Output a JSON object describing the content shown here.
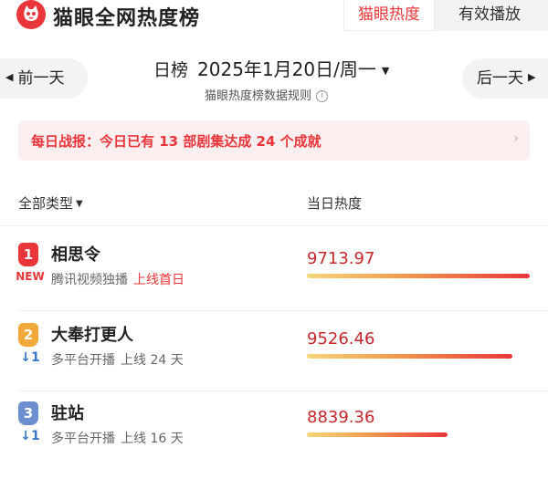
{
  "header": {
    "app_title": "猫眼全网热度榜",
    "tabs": [
      {
        "label": "猫眼热度",
        "active": true
      },
      {
        "label": "有效播放",
        "active": false
      }
    ],
    "brand_color": "#e8363a"
  },
  "date_nav": {
    "prev_label": "前一天",
    "next_label": "后一天",
    "rank_type": "日榜",
    "date": "2025年1月20日/周一",
    "rules_link": "猫眼热度榜数据规则"
  },
  "notice": {
    "text": "每日战报：今日已有 13 部剧集达成 24 个成就"
  },
  "list_header": {
    "filter_label": "全部类型",
    "heat_column": "当日热度"
  },
  "rows": [
    {
      "rank": "1",
      "change": "NEW",
      "title": "相思令",
      "platform": "腾讯视频独播",
      "days": "上线首日",
      "heat": "9713.97",
      "heat_value": 9713.97
    },
    {
      "rank": "2",
      "change": "↓1",
      "title": "大奉打更人",
      "platform": "多平台开播",
      "days": "上线 24 天",
      "heat": "9526.46",
      "heat_value": 9526.46
    },
    {
      "rank": "3",
      "change": "↓1",
      "title": "驻站",
      "platform": "多平台开播",
      "days": "上线 16 天",
      "heat": "8839.36",
      "heat_value": 8839.36
    }
  ]
}
